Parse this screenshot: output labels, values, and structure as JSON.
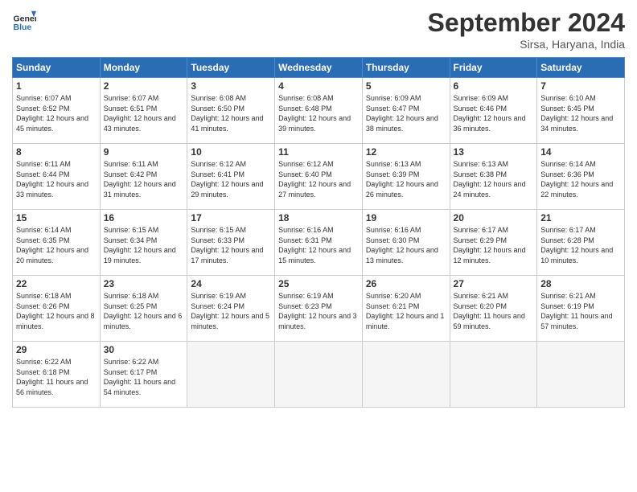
{
  "header": {
    "logo_text_general": "General",
    "logo_text_blue": "Blue",
    "month_title": "September 2024",
    "location": "Sirsa, Haryana, India"
  },
  "weekdays": [
    "Sunday",
    "Monday",
    "Tuesday",
    "Wednesday",
    "Thursday",
    "Friday",
    "Saturday"
  ],
  "weeks": [
    [
      {
        "day": "1",
        "sunrise": "6:07 AM",
        "sunset": "6:52 PM",
        "daylight": "12 hours and 45 minutes."
      },
      {
        "day": "2",
        "sunrise": "6:07 AM",
        "sunset": "6:51 PM",
        "daylight": "12 hours and 43 minutes."
      },
      {
        "day": "3",
        "sunrise": "6:08 AM",
        "sunset": "6:50 PM",
        "daylight": "12 hours and 41 minutes."
      },
      {
        "day": "4",
        "sunrise": "6:08 AM",
        "sunset": "6:48 PM",
        "daylight": "12 hours and 39 minutes."
      },
      {
        "day": "5",
        "sunrise": "6:09 AM",
        "sunset": "6:47 PM",
        "daylight": "12 hours and 38 minutes."
      },
      {
        "day": "6",
        "sunrise": "6:09 AM",
        "sunset": "6:46 PM",
        "daylight": "12 hours and 36 minutes."
      },
      {
        "day": "7",
        "sunrise": "6:10 AM",
        "sunset": "6:45 PM",
        "daylight": "12 hours and 34 minutes."
      }
    ],
    [
      {
        "day": "8",
        "sunrise": "6:11 AM",
        "sunset": "6:44 PM",
        "daylight": "12 hours and 33 minutes."
      },
      {
        "day": "9",
        "sunrise": "6:11 AM",
        "sunset": "6:42 PM",
        "daylight": "12 hours and 31 minutes."
      },
      {
        "day": "10",
        "sunrise": "6:12 AM",
        "sunset": "6:41 PM",
        "daylight": "12 hours and 29 minutes."
      },
      {
        "day": "11",
        "sunrise": "6:12 AM",
        "sunset": "6:40 PM",
        "daylight": "12 hours and 27 minutes."
      },
      {
        "day": "12",
        "sunrise": "6:13 AM",
        "sunset": "6:39 PM",
        "daylight": "12 hours and 26 minutes."
      },
      {
        "day": "13",
        "sunrise": "6:13 AM",
        "sunset": "6:38 PM",
        "daylight": "12 hours and 24 minutes."
      },
      {
        "day": "14",
        "sunrise": "6:14 AM",
        "sunset": "6:36 PM",
        "daylight": "12 hours and 22 minutes."
      }
    ],
    [
      {
        "day": "15",
        "sunrise": "6:14 AM",
        "sunset": "6:35 PM",
        "daylight": "12 hours and 20 minutes."
      },
      {
        "day": "16",
        "sunrise": "6:15 AM",
        "sunset": "6:34 PM",
        "daylight": "12 hours and 19 minutes."
      },
      {
        "day": "17",
        "sunrise": "6:15 AM",
        "sunset": "6:33 PM",
        "daylight": "12 hours and 17 minutes."
      },
      {
        "day": "18",
        "sunrise": "6:16 AM",
        "sunset": "6:31 PM",
        "daylight": "12 hours and 15 minutes."
      },
      {
        "day": "19",
        "sunrise": "6:16 AM",
        "sunset": "6:30 PM",
        "daylight": "12 hours and 13 minutes."
      },
      {
        "day": "20",
        "sunrise": "6:17 AM",
        "sunset": "6:29 PM",
        "daylight": "12 hours and 12 minutes."
      },
      {
        "day": "21",
        "sunrise": "6:17 AM",
        "sunset": "6:28 PM",
        "daylight": "12 hours and 10 minutes."
      }
    ],
    [
      {
        "day": "22",
        "sunrise": "6:18 AM",
        "sunset": "6:26 PM",
        "daylight": "12 hours and 8 minutes."
      },
      {
        "day": "23",
        "sunrise": "6:18 AM",
        "sunset": "6:25 PM",
        "daylight": "12 hours and 6 minutes."
      },
      {
        "day": "24",
        "sunrise": "6:19 AM",
        "sunset": "6:24 PM",
        "daylight": "12 hours and 5 minutes."
      },
      {
        "day": "25",
        "sunrise": "6:19 AM",
        "sunset": "6:23 PM",
        "daylight": "12 hours and 3 minutes."
      },
      {
        "day": "26",
        "sunrise": "6:20 AM",
        "sunset": "6:21 PM",
        "daylight": "12 hours and 1 minute."
      },
      {
        "day": "27",
        "sunrise": "6:21 AM",
        "sunset": "6:20 PM",
        "daylight": "11 hours and 59 minutes."
      },
      {
        "day": "28",
        "sunrise": "6:21 AM",
        "sunset": "6:19 PM",
        "daylight": "11 hours and 57 minutes."
      }
    ],
    [
      {
        "day": "29",
        "sunrise": "6:22 AM",
        "sunset": "6:18 PM",
        "daylight": "11 hours and 56 minutes."
      },
      {
        "day": "30",
        "sunrise": "6:22 AM",
        "sunset": "6:17 PM",
        "daylight": "11 hours and 54 minutes."
      },
      null,
      null,
      null,
      null,
      null
    ]
  ]
}
